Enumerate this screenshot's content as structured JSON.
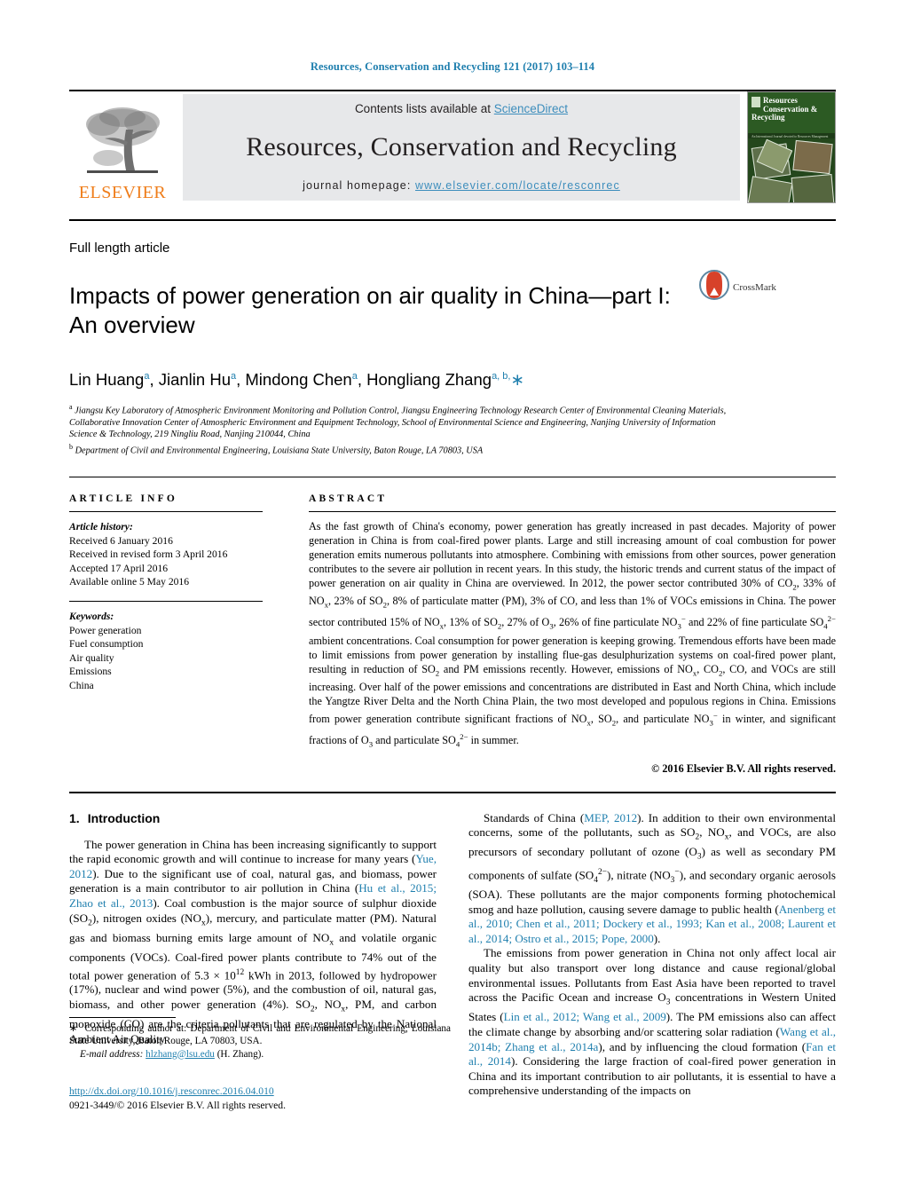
{
  "running_head": "Resources, Conservation and Recycling 121 (2017) 103–114",
  "masthead": {
    "contents_prefix": "Contents lists available at ",
    "sciencedirect": "ScienceDirect",
    "journal_title": "Resources, Conservation and Recycling",
    "homepage_prefix": "journal homepage: ",
    "homepage_url": "www.elsevier.com/locate/resconrec",
    "publisher": "ELSEVIER",
    "cover": {
      "title_line1": "Resources",
      "title_line2": "Conservation &",
      "title_line3": "Recycling",
      "subtitle": "An International Journal devoted to Resources Management and Environmental Studies"
    },
    "colors": {
      "link": "#3c8dbc",
      "elsevier_orange": "#ef7d1a",
      "banner_bg": "#e7e8ea",
      "cover_green": "#1d3b17"
    }
  },
  "article": {
    "type": "Full length article",
    "title": "Impacts of power generation on air quality in China—part I: An overview",
    "crossmark_label": "CrossMark",
    "authors_html": "Lin Huang<sup>a</sup>, Jianlin Hu<sup>a</sup>, Mindong Chen<sup>a</sup>, Hongliang Zhang<sup>a, b,</sup><span class=\"star\">∗</span>",
    "affiliation_a": "Jiangsu Key Laboratory of Atmospheric Environment Monitoring and Pollution Control, Jiangsu Engineering Technology Research Center of Environmental Cleaning Materials, Collaborative Innovation Center of Atmospheric Environment and Equipment Technology, School of Environmental Science and Engineering, Nanjing University of Information Science & Technology, 219 Ningliu Road, Nanjing 210044, China",
    "affiliation_b": "Department of Civil and Environmental Engineering, Louisiana State University, Baton Rouge, LA 70803, USA"
  },
  "article_info": {
    "heading": "ARTICLE INFO",
    "history_label": "Article history:",
    "history": [
      "Received 6 January 2016",
      "Received in revised form 3 April 2016",
      "Accepted 17 April 2016",
      "Available online 5 May 2016"
    ],
    "keywords_label": "Keywords:",
    "keywords": [
      "Power generation",
      "Fuel consumption",
      "Air quality",
      "Emissions",
      "China"
    ]
  },
  "abstract": {
    "heading": "ABSTRACT",
    "text_html": "As the fast growth of China's economy, power generation has greatly increased in past decades. Majority of power generation in China is from coal-fired power plants. Large and still increasing amount of coal combustion for power generation emits numerous pollutants into atmosphere. Combining with emissions from other sources, power generation contributes to the severe air pollution in recent years. In this study, the historic trends and current status of the impact of power generation on air quality in China are overviewed. In 2012, the power sector contributed 30% of CO<sub>2</sub>, 33% of NO<sub>x</sub>, 23% of SO<sub>2</sub>, 8% of particulate matter (PM), 3% of CO, and less than 1% of VOCs emissions in China. The power sector contributed 15% of NO<sub>x</sub>, 13% of SO<sub>2</sub>, 27% of O<sub>3</sub>, 26% of fine particulate NO<sub>3</sub><sup>−</sup> and 22% of fine particulate SO<sub>4</sub><sup>2−</sup> ambient concentrations. Coal consumption for power generation is keeping growing. Tremendous efforts have been made to limit emissions from power generation by installing flue-gas desulphurization systems on coal-fired power plant, resulting in reduction of SO<sub>2</sub> and PM emissions recently. However, emissions of NO<sub>x</sub>, CO<sub>2</sub>, CO, and VOCs are still increasing. Over half of the power emissions and concentrations are distributed in East and North China, which include the Yangtze River Delta and the North China Plain, the two most developed and populous regions in China. Emissions from power generation contribute significant fractions of NO<sub>x</sub>, SO<sub>2</sub>, and particulate NO<sub>3</sub><sup>−</sup> in winter, and significant fractions of O<sub>3</sub> and particulate SO<sub>4</sub><sup>2−</sup> in summer.",
    "copyright": "© 2016 Elsevier B.V. All rights reserved."
  },
  "sections": {
    "intro_number": "1.",
    "intro_title": "Introduction",
    "left_paragraph_html": "The power generation in China has been increasing significantly to support the rapid economic growth and will continue to increase for many years (<span class=\"cite\">Yue, 2012</span>). Due to the significant use of coal, natural gas, and biomass, power generation is a main contributor to air pollution in China (<span class=\"cite\">Hu et al., 2015; Zhao et al., 2013</span>). Coal combustion is the major source of sulphur dioxide (SO<sub>2</sub>), nitrogen oxides (NO<sub>x</sub>), mercury, and particulate matter (PM). Natural gas and biomass burning emits large amount of NO<sub>x</sub> and volatile organic components (VOCs). Coal-fired power plants contribute to 74% out of the total power generation of 5.3 × 10<sup>12</sup> kWh in 2013, followed by hydropower (17%), nuclear and wind power (5%), and the combustion of oil, natural gas, biomass, and other power generation (4%). SO<sub>2</sub>, NO<sub>x</sub>, PM, and carbon monoxide (CO) are the criteria pollutants that are regulated by the National Ambient Air Quality",
    "right_paragraph1_html": "Standards of China (<span class=\"cite\">MEP, 2012</span>). In addition to their own environmental concerns, some of the pollutants, such as SO<sub>2</sub>, NO<sub>x</sub>, and VOCs, are also precursors of secondary pollutant of ozone (O<sub>3</sub>) as well as secondary PM components of sulfate (SO<sub>4</sub><sup>2−</sup>), nitrate (NO<sub>3</sub><sup>−</sup>), and secondary organic aerosols (SOA). These pollutants are the major components forming photochemical smog and haze pollution, causing severe damage to public health (<span class=\"cite\">Anenberg et al., 2010; Chen et al., 2011; Dockery et al., 1993; Kan et al., 2008; Laurent et al., 2014; Ostro et al., 2015; Pope, 2000</span>).",
    "right_paragraph2_html": "The emissions from power generation in China not only affect local air quality but also transport over long distance and cause regional/global environmental issues. Pollutants from East Asia have been reported to travel across the Pacific Ocean and increase O<sub>3</sub> concentrations in Western United States (<span class=\"cite\">Lin et al., 2012; Wang et al., 2009</span>). The PM emissions also can affect the climate change by absorbing and/or scattering solar radiation (<span class=\"cite\">Wang et al., 2014b; Zhang et al., 2014a</span>), and by influencing the cloud formation (<span class=\"cite\">Fan et al., 2014</span>). Considering the large fraction of coal-fired power generation in China and its important contribution to air pollutants, it is essential to have a comprehensive understanding of the impacts on"
  },
  "footnote": {
    "marker": "∗",
    "corresponding_html": "&nbsp;&nbsp;Corresponding author at: Department of Civil and Environmental Engineering, Louisiana State University, Baton Rouge, LA 70803, USA.",
    "email_label": "E-mail address:",
    "email": "hlzhang@lsu.edu",
    "email_owner": "(H. Zhang)."
  },
  "footer": {
    "doi": "http://dx.doi.org/10.1016/j.resconrec.2016.04.010",
    "issn_copyright": "0921-3449/© 2016 Elsevier B.V. All rights reserved."
  }
}
